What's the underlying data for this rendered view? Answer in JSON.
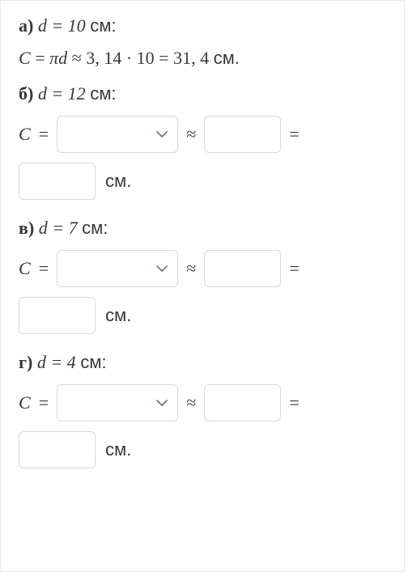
{
  "problems": {
    "a": {
      "label": "а)",
      "given": "d = 10 см:",
      "worked": "C = πd ≈ 3, 14 · 10 = 31, 4 см."
    },
    "b": {
      "label": "б)",
      "given": "d = 12 см:",
      "lhs": "C",
      "eq1": "=",
      "approx": "≈",
      "eq2": "=",
      "unit": "см."
    },
    "v": {
      "label": "в)",
      "given": "d = 7 см:",
      "lhs": "C",
      "eq1": "=",
      "approx": "≈",
      "eq2": "=",
      "unit": "см."
    },
    "g": {
      "label": "г)",
      "given": "d = 4 см:",
      "lhs": "C",
      "eq1": "=",
      "approx": "≈",
      "eq2": "=",
      "unit": "см."
    }
  }
}
